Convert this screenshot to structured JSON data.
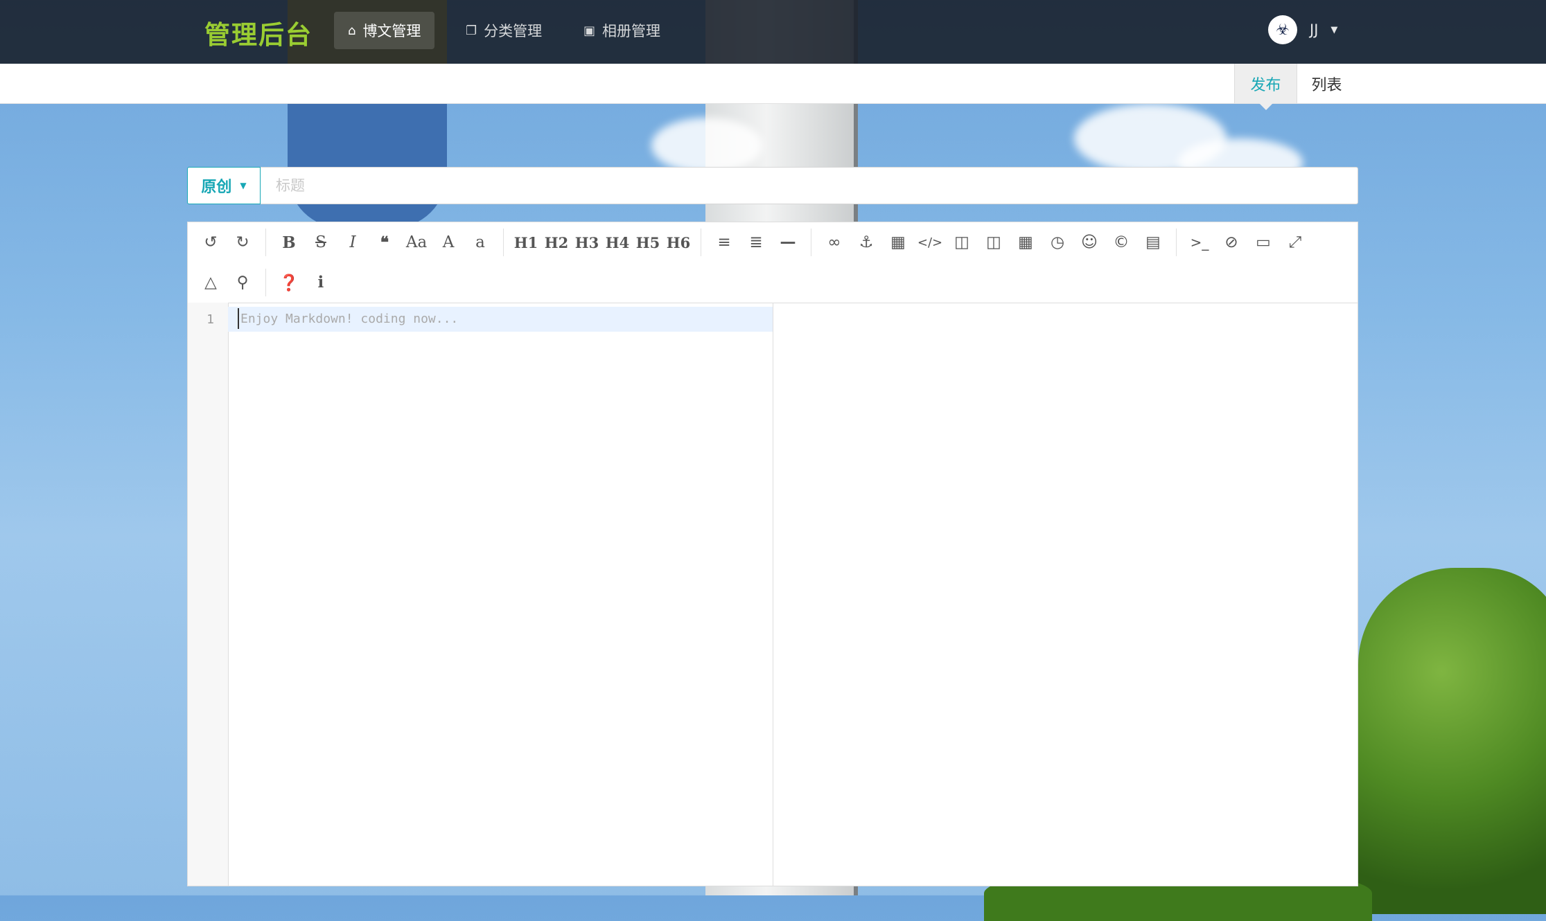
{
  "header": {
    "brand": "管理后台",
    "nav": [
      {
        "label": "博文管理",
        "icon": "home-icon",
        "active": true
      },
      {
        "label": "分类管理",
        "icon": "copy-icon",
        "active": false
      },
      {
        "label": "相册管理",
        "icon": "image-icon",
        "active": false
      }
    ],
    "user": {
      "name": "JJ",
      "avatar_icon": "avatar-icon"
    }
  },
  "subnav": {
    "tabs": [
      {
        "label": "发布",
        "active": true
      },
      {
        "label": "列表",
        "active": false
      }
    ]
  },
  "post_form": {
    "type_selected": "原创",
    "title_placeholder": "标题",
    "title_value": ""
  },
  "editor": {
    "toolbar_row1": [
      "undo",
      "redo",
      "|",
      "bold",
      "strikethrough",
      "italic",
      "quote",
      "uppercase-first",
      "uppercase",
      "lowercase",
      "|",
      "H1",
      "H2",
      "H3",
      "H4",
      "H5",
      "H6",
      "|",
      "unordered-list",
      "ordered-list",
      "hr",
      "|",
      "link",
      "anchor",
      "image",
      "code",
      "preformatted",
      "code-block",
      "table",
      "datetime",
      "emoji",
      "html-entities",
      "pagebreak",
      "|",
      "goto-line",
      "watch",
      "preview",
      "fullscreen"
    ],
    "toolbar_row2": [
      "clear",
      "search",
      "|",
      "help",
      "info"
    ],
    "heading_labels": [
      "H1",
      "H2",
      "H3",
      "H4",
      "H5",
      "H6"
    ],
    "line_number": "1",
    "placeholder": "Enjoy Markdown! coding now..."
  },
  "colors": {
    "accent": "#18a7b5",
    "brand": "#9acd32",
    "topbar": "#1c242e"
  }
}
